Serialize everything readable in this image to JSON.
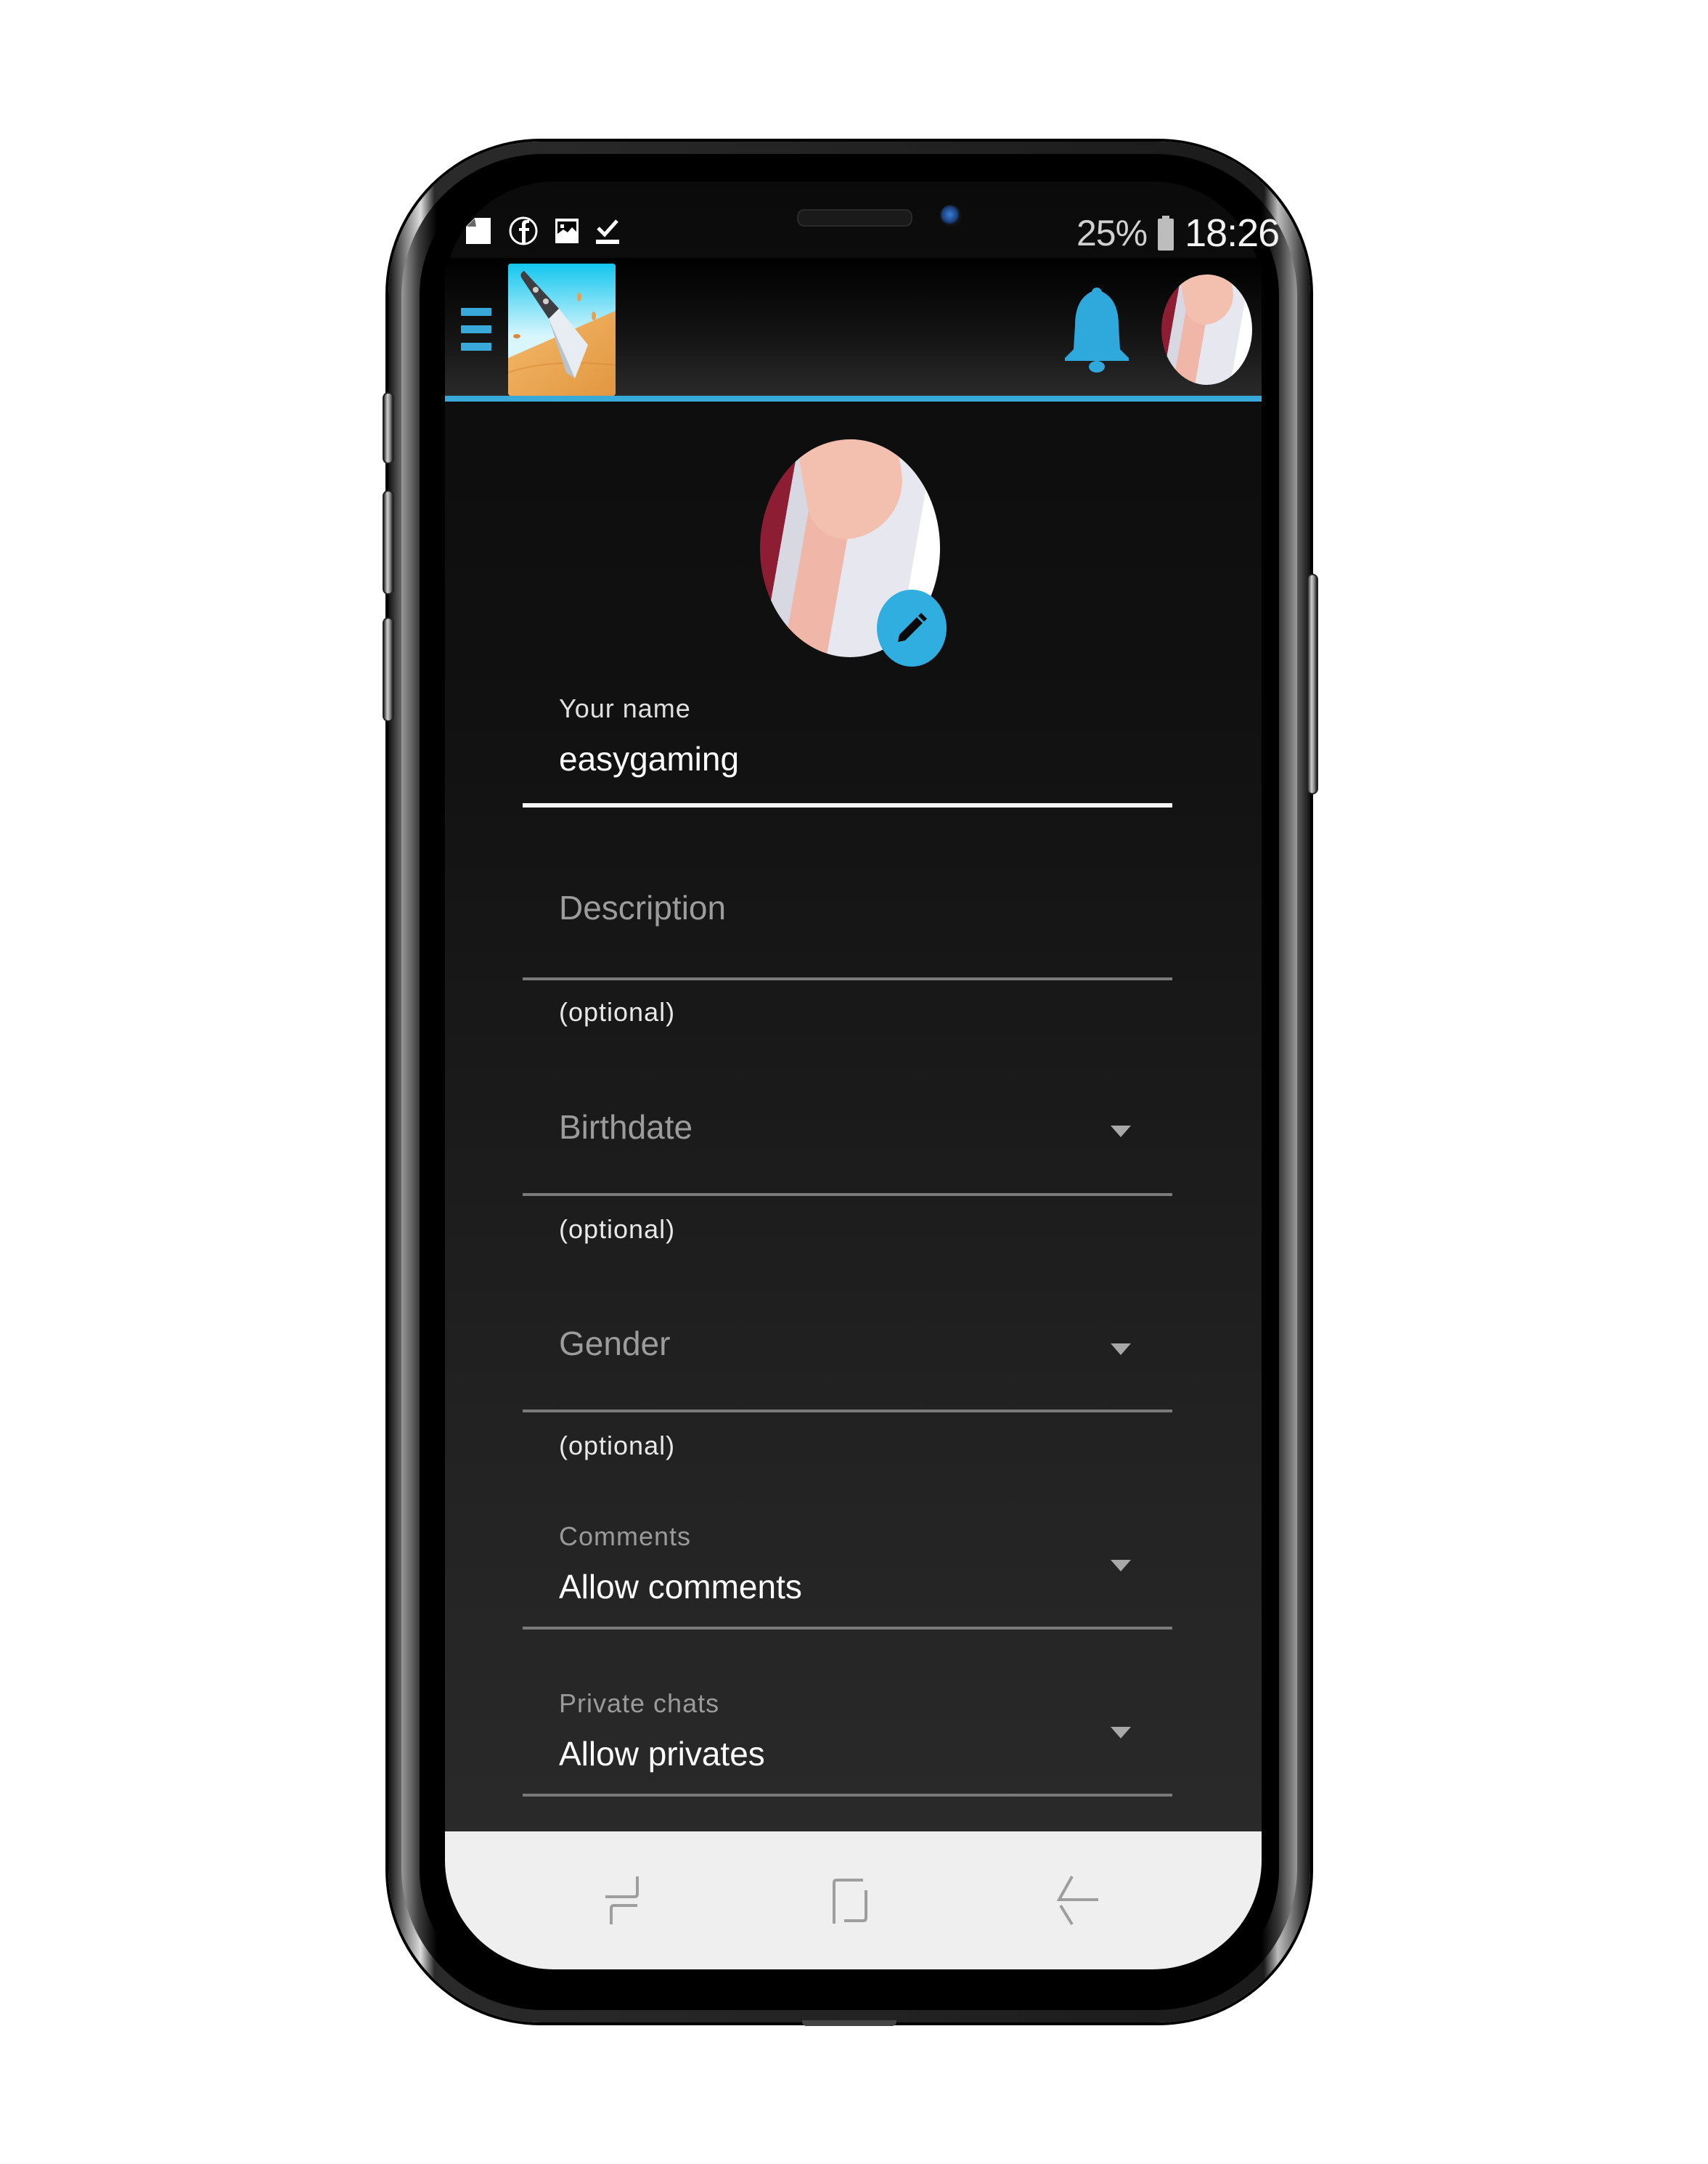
{
  "status_bar": {
    "left_icons": [
      "sim-card-icon",
      "facebook-icon",
      "image-icon",
      "download-done-icon"
    ],
    "battery_percent": "25%",
    "battery_icon": "battery-icon",
    "time": "18:26"
  },
  "header": {
    "menu_icon": "hamburger-menu-icon",
    "app_icon": "knife-game-app-icon",
    "notifications_icon": "bell-icon",
    "profile_avatar": "user-avatar",
    "accent_color": "#38a9d9"
  },
  "profile": {
    "avatar": "profile-photo",
    "edit_icon": "pencil-icon",
    "edit_badge_color": "#31aee0"
  },
  "form": {
    "name": {
      "label": "Your name",
      "value": "easygaming"
    },
    "description": {
      "placeholder": "Description",
      "helper": "(optional)"
    },
    "birthdate": {
      "placeholder": "Birthdate",
      "helper": "(optional)"
    },
    "gender": {
      "placeholder": "Gender",
      "helper": "(optional)"
    },
    "comments": {
      "label": "Comments",
      "value": "Allow comments"
    },
    "private_chats": {
      "label": "Private chats",
      "value": "Allow privates"
    }
  },
  "nav_bar": {
    "buttons": [
      "recent-apps-icon",
      "home-icon",
      "back-icon"
    ]
  }
}
